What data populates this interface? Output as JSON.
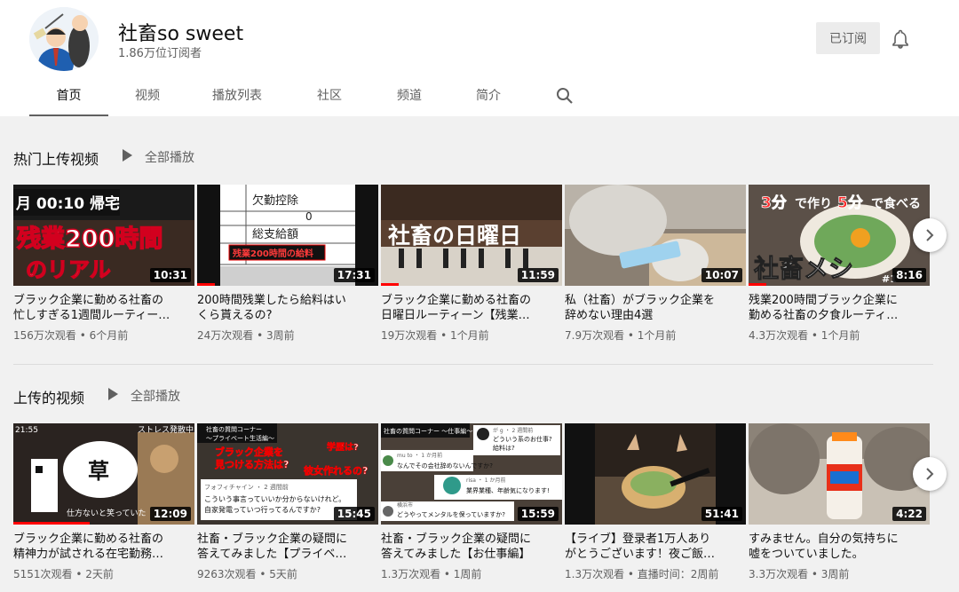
{
  "channel": {
    "name": "社畜so sweet",
    "subscribers": "1.86万位订阅者",
    "subscribe_label": "已订阅"
  },
  "tabs": [
    {
      "label": "首页",
      "active": true
    },
    {
      "label": "视频"
    },
    {
      "label": "播放列表"
    },
    {
      "label": "社区"
    },
    {
      "label": "频道"
    },
    {
      "label": "简介"
    }
  ],
  "icons": {
    "bell": "bell-icon",
    "search": "search-icon",
    "next": "chevron-right-icon",
    "play": "play-icon"
  },
  "colors": {
    "progress": "#ff0000",
    "accent_text": "#606060"
  },
  "sections": [
    {
      "title": "热门上传视频",
      "play_all": "全部播放",
      "videos": [
        {
          "title_lines": [
            "ブラック企業に勤める社畜の",
            "忙しすぎる1週間ルーティー…"
          ],
          "meta": "156万次观看 • 6个月前",
          "duration": "10:31",
          "overlay": [
            "月 00:10 帰宅",
            "残業200時間",
            "のリアル"
          ]
        },
        {
          "title_lines": [
            "200時間残業したら給料はい",
            "くら貰えるの?"
          ],
          "meta": "24万次观看 • 3周前",
          "duration": "17:31",
          "overlay": [
            "欠勤控除",
            "0",
            "総支給額",
            "残業200時間の給料"
          ],
          "progress": 0.1
        },
        {
          "title_lines": [
            "ブラック企業に勤める社畜の",
            "日曜日ルーティーン【残業…"
          ],
          "meta": "19万次观看 • 1个月前",
          "duration": "11:59",
          "overlay": [
            "社畜の日曜日"
          ],
          "progress": 0.1
        },
        {
          "title_lines": [
            "私（社畜）がブラック企業を",
            "辞めない理由4選"
          ],
          "meta": "7.9万次观看 • 1个月前",
          "duration": "10:07"
        },
        {
          "title_lines": [
            "残業200時間ブラック企業に",
            "勤める社畜の夕食ルーティ…"
          ],
          "meta": "4.3万次观看 • 1个月前",
          "duration": "8:16",
          "overlay": [
            "3分",
            "で作り",
            "5分",
            "で食べる",
            "社畜メシ",
            "#1"
          ],
          "progress": 0.1
        }
      ]
    },
    {
      "title": "上传的视频",
      "play_all": "全部播放",
      "videos": [
        {
          "title_lines": [
            "ブラック企業に勤める社畜の",
            "精神力が試される在宅勤務…"
          ],
          "meta": "5151次观看 • 2天前",
          "duration": "12:09",
          "overlay": [
            "21:55",
            "ストレス発散中",
            "草",
            "仕方ないと笑っていた"
          ],
          "progress": 0.42
        },
        {
          "title_lines": [
            "社畜・ブラック企業の疑問に",
            "答えてみました【プライベ…"
          ],
          "meta": "9263次观看 • 5天前",
          "duration": "15:45",
          "overlay": [
            "社畜の質問コーナー",
            "〜プライベート生活編〜",
            "ブラック企業を",
            "見つける方法は?",
            "彼女作れるの?",
            "学歴は?",
            "フォフィチャイン ・ 2 週間前",
            "こういう事言っていいか分からないけれど。",
            "自家発電っていつ行ってるんですか?"
          ]
        },
        {
          "title_lines": [
            "社畜・ブラック企業の疑問に",
            "答えてみました【お仕事編】"
          ],
          "meta": "1.3万次观看 • 1周前",
          "duration": "15:59",
          "overlay": [
            "社畜の質問コーナー 〜仕事編〜",
            "が g ・ 2 週間前",
            "どういう系のお仕事?",
            "給料は?",
            "mu to ・ 1 か月前",
            "なんでその会社辞めないんですか?",
            "risa ・ 1 か月前",
            "業界業種、年齢気になります!",
            "横浜市",
            "どうやってメンタルを保っていますか?"
          ]
        },
        {
          "title_lines": [
            "【ライブ】登录者1万人あり",
            "がとうございます！夜ご飯…"
          ],
          "meta": "1.3万次观看 • 直播时间：2周前",
          "duration": "51:41"
        },
        {
          "title_lines": [
            "すみません。自分の気持ちに",
            "嘘をついていました。"
          ],
          "meta": "3.3万次观看 • 3周前",
          "duration": "4:22"
        }
      ]
    }
  ]
}
